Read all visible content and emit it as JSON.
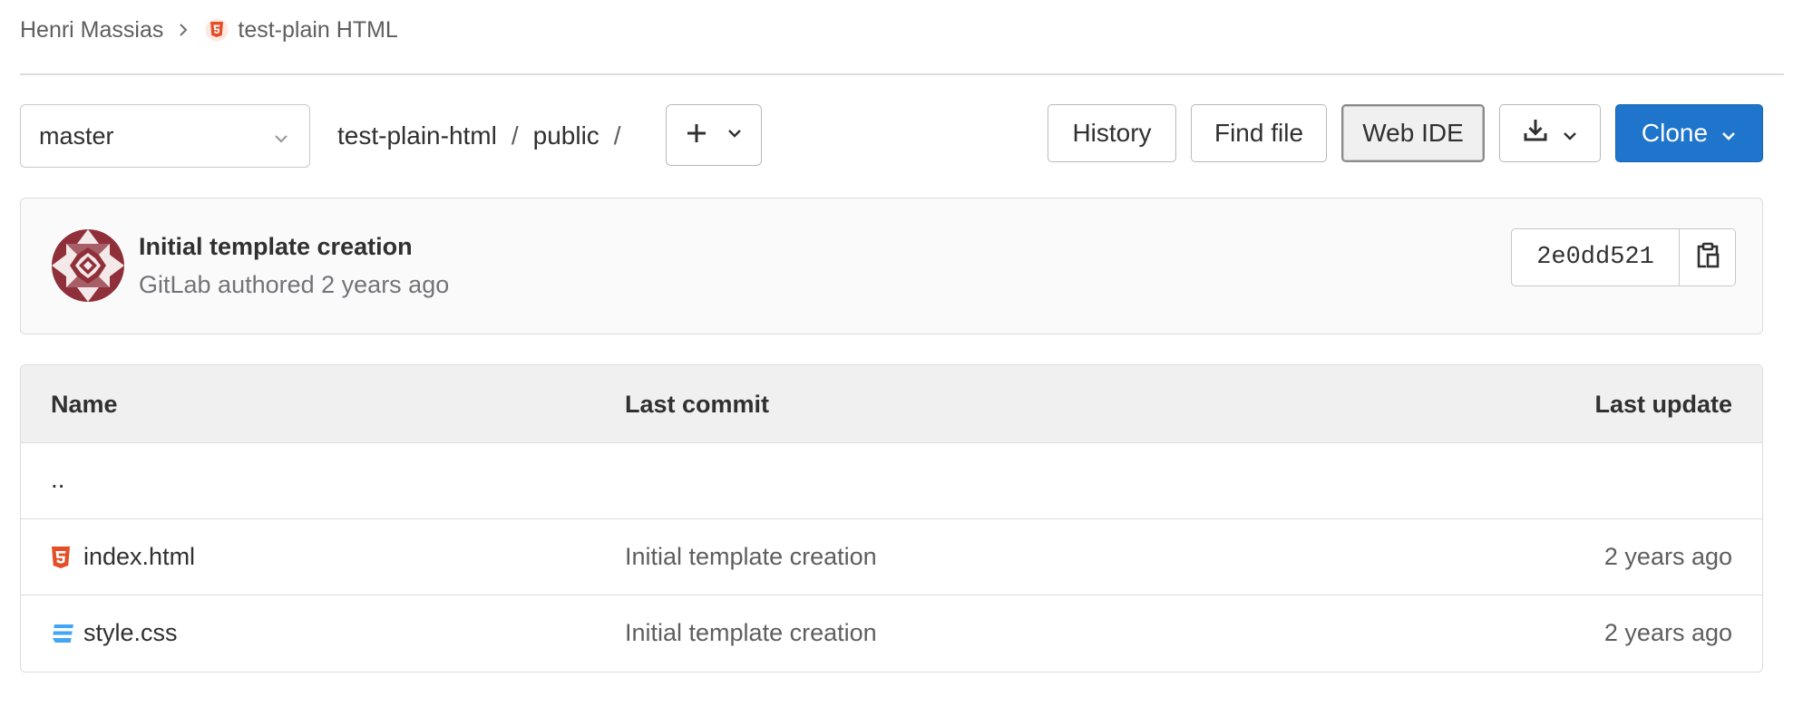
{
  "breadcrumb": {
    "owner": "Henri Massias",
    "project": "test-plain HTML",
    "project_icon": "html5-icon",
    "separator_icon": "chevron-right-icon"
  },
  "toolbar": {
    "branch": "master",
    "path": [
      "test-plain-html",
      "public"
    ],
    "path_separator": "/",
    "add_icon": "plus-icon",
    "history_label": "History",
    "find_file_label": "Find file",
    "web_ide_label": "Web IDE",
    "download_icon": "download-icon",
    "clone_label": "Clone"
  },
  "commit": {
    "title": "Initial template creation",
    "meta": "GitLab authored 2 years ago",
    "sha": "2e0dd521",
    "copy_icon": "clipboard-icon"
  },
  "file_table": {
    "headers": {
      "name": "Name",
      "last_commit": "Last commit",
      "last_update": "Last update"
    },
    "parent_dir": "..",
    "rows": [
      {
        "name": "index.html",
        "icon": "html5-icon",
        "last_commit": "Initial template creation",
        "last_update": "2 years ago"
      },
      {
        "name": "style.css",
        "icon": "css3-icon",
        "last_commit": "Initial template creation",
        "last_update": "2 years ago"
      }
    ]
  },
  "colors": {
    "primary": "#1f75cb",
    "html_icon": "#e44d26",
    "css_icon": "#42a5f5",
    "avatar": "#8f2f3a"
  }
}
